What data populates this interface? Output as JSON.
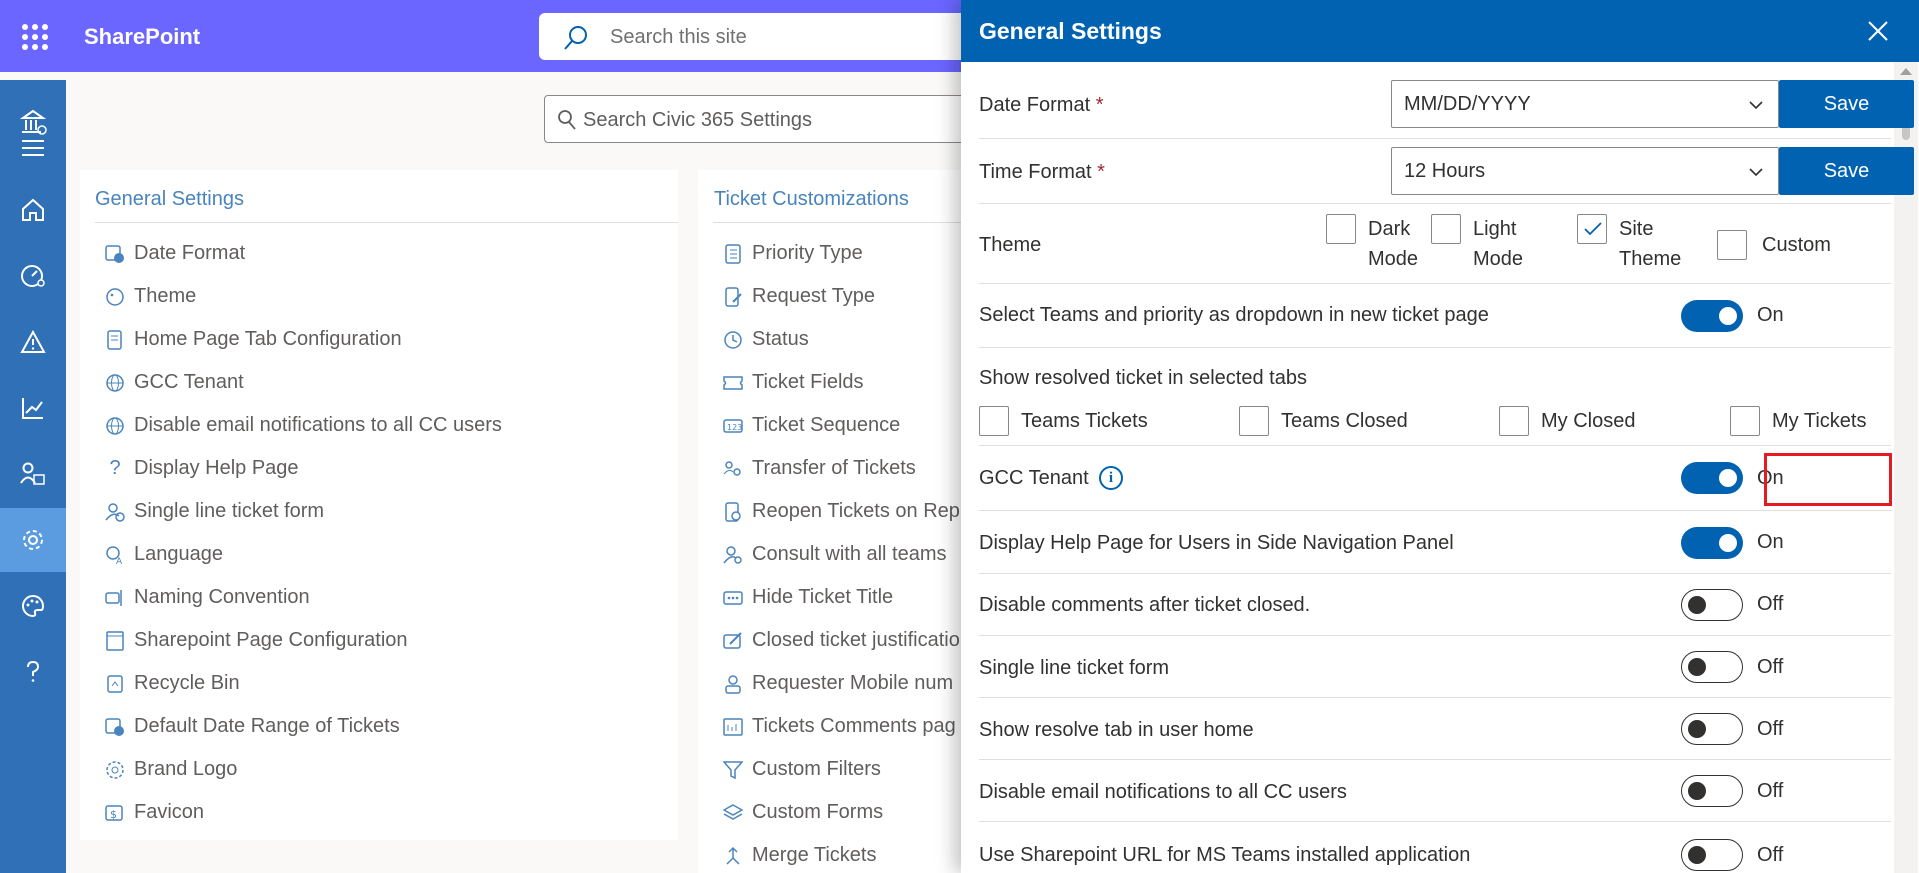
{
  "topbar": {
    "brand": "SharePoint",
    "search_placeholder": "Search this site"
  },
  "page": {
    "search_placeholder": "Search Civic 365 Settings"
  },
  "general_settings_card": {
    "title": "General Settings",
    "items": [
      {
        "label": "Date Format",
        "icon": "calendar-clock-icon"
      },
      {
        "label": "Theme",
        "icon": "palette-icon"
      },
      {
        "label": "Home Page Tab Configuration",
        "icon": "document-icon"
      },
      {
        "label": "GCC Tenant",
        "icon": "globe-icon"
      },
      {
        "label": "Disable email notifications to all CC users",
        "icon": "globe-icon"
      },
      {
        "label": "Display Help Page",
        "icon": "question-icon"
      },
      {
        "label": "Single line ticket form",
        "icon": "person-remove-icon"
      },
      {
        "label": "Language",
        "icon": "translate-icon"
      },
      {
        "label": "Naming Convention",
        "icon": "rename-icon"
      },
      {
        "label": "Sharepoint Page Configuration",
        "icon": "page-icon"
      },
      {
        "label": "Recycle Bin",
        "icon": "recycle-bin-icon"
      },
      {
        "label": "Default Date Range of Tickets",
        "icon": "calendar-clock-icon"
      },
      {
        "label": "Brand Logo",
        "icon": "badge-icon"
      },
      {
        "label": "Favicon",
        "icon": "dollar-badge-icon"
      }
    ]
  },
  "ticket_card": {
    "title": "Ticket Customizations",
    "items": [
      {
        "label": "Priority Type",
        "icon": "checklist-icon"
      },
      {
        "label": "Request Type",
        "icon": "document-edit-icon"
      },
      {
        "label": "Status",
        "icon": "clock-icon"
      },
      {
        "label": "Ticket Fields",
        "icon": "ticket-icon"
      },
      {
        "label": "Ticket Sequence",
        "icon": "number-icon"
      },
      {
        "label": "Transfer of Tickets",
        "icon": "people-swap-icon"
      },
      {
        "label": "Reopen Tickets on Rep",
        "icon": "document-refresh-icon"
      },
      {
        "label": "Consult with all teams",
        "icon": "person-search-icon"
      },
      {
        "label": "Hide Ticket Title",
        "icon": "dots-icon"
      },
      {
        "label": "Closed ticket justificatio",
        "icon": "edit-box-icon"
      },
      {
        "label": "Requester Mobile num",
        "icon": "person-phone-icon"
      },
      {
        "label": "Tickets Comments pag",
        "icon": "comments-icon"
      },
      {
        "label": "Custom Filters",
        "icon": "filter-icon"
      },
      {
        "label": "Custom Forms",
        "icon": "layers-icon"
      },
      {
        "label": "Merge Tickets",
        "icon": "merge-icon"
      }
    ]
  },
  "panel": {
    "title": "General Settings",
    "date_format": {
      "label": "Date Format",
      "value": "MM/DD/YYYY",
      "save": "Save"
    },
    "time_format": {
      "label": "Time Format",
      "value": "12 Hours",
      "save": "Save"
    },
    "theme": {
      "label": "Theme",
      "options": [
        {
          "line1": "Dark",
          "line2": "Mode",
          "checked": false
        },
        {
          "line1": "Light",
          "line2": "Mode",
          "checked": false
        },
        {
          "line1": "Site",
          "line2": "Theme",
          "checked": true
        },
        {
          "line1": "Custom",
          "line2": "",
          "checked": false
        }
      ]
    },
    "teams_priority": {
      "label": "Select Teams and priority as dropdown in new ticket page",
      "state": "On"
    },
    "resolved_tabs": {
      "label": "Show resolved ticket in selected tabs",
      "options": [
        "Teams Tickets",
        "Teams Closed",
        "My Closed",
        "My Tickets"
      ]
    },
    "gcc_tenant": {
      "label": "GCC Tenant",
      "info": "i",
      "state": "On"
    },
    "help_page": {
      "label": "Display Help Page for Users in Side Navigation Panel",
      "state": "On"
    },
    "disable_comments": {
      "label": "Disable comments after ticket closed.",
      "state": "Off"
    },
    "single_line": {
      "label": "Single line ticket form",
      "state": "Off"
    },
    "resolve_tab": {
      "label": "Show resolve tab in user home",
      "state": "Off"
    },
    "disable_email": {
      "label": "Disable email notifications to all CC users",
      "state": "Off"
    },
    "sharepoint_url": {
      "label": "Use Sharepoint URL for MS Teams installed application",
      "state": "Off"
    }
  },
  "colors": {
    "topbar": "#6b66ff",
    "rail": "#2f70b7",
    "primary": "#0062b0",
    "highlight": "#e51b24"
  }
}
